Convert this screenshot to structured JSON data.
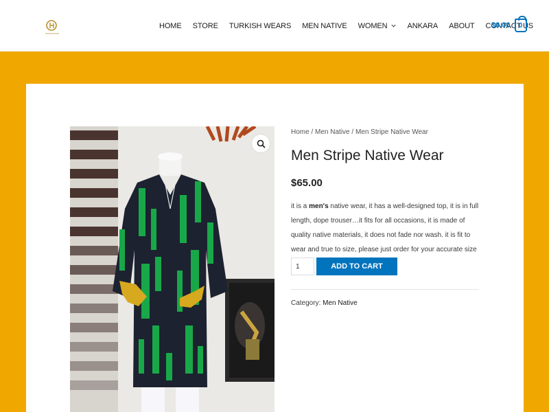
{
  "header": {
    "nav": [
      {
        "label": "HOME"
      },
      {
        "label": "STORE"
      },
      {
        "label": "TURKISH WEARS"
      },
      {
        "label": "MEN NATIVE"
      },
      {
        "label": "WOMEN",
        "has_dropdown": true
      },
      {
        "label": "ANKARA"
      },
      {
        "label": "ABOUT"
      },
      {
        "label": "CONTACT US"
      }
    ],
    "cart_total": "$0.00",
    "cart_count": "0"
  },
  "colors": {
    "accent": "#0274be",
    "band": "#f0a800",
    "logo_gold": "#b8902e"
  },
  "breadcrumb": {
    "home": "Home",
    "sep1": " / ",
    "category": "Men Native",
    "sep2": " / ",
    "current": "Men Stripe Native Wear"
  },
  "product": {
    "title": "Men Stripe Native Wear",
    "price": "$65.00",
    "desc_before": "it is a ",
    "desc_bold": "men's",
    "desc_after": " native wear, it has a well-designed top, it is in full length, dope trouser…it fits for all occasions, it is made of quality native materials, it does not fade nor wash. it is fit to wear and true to size, please just order for your accurate size",
    "quantity": "1",
    "add_to_cart_label": "ADD TO CART",
    "category_label": "Category: ",
    "category_value": "Men Native"
  },
  "icons": {
    "zoom": "magnifier-icon",
    "cart": "shopping-bag-icon",
    "dropdown": "chevron-down-icon",
    "logo": "brand-logo"
  }
}
